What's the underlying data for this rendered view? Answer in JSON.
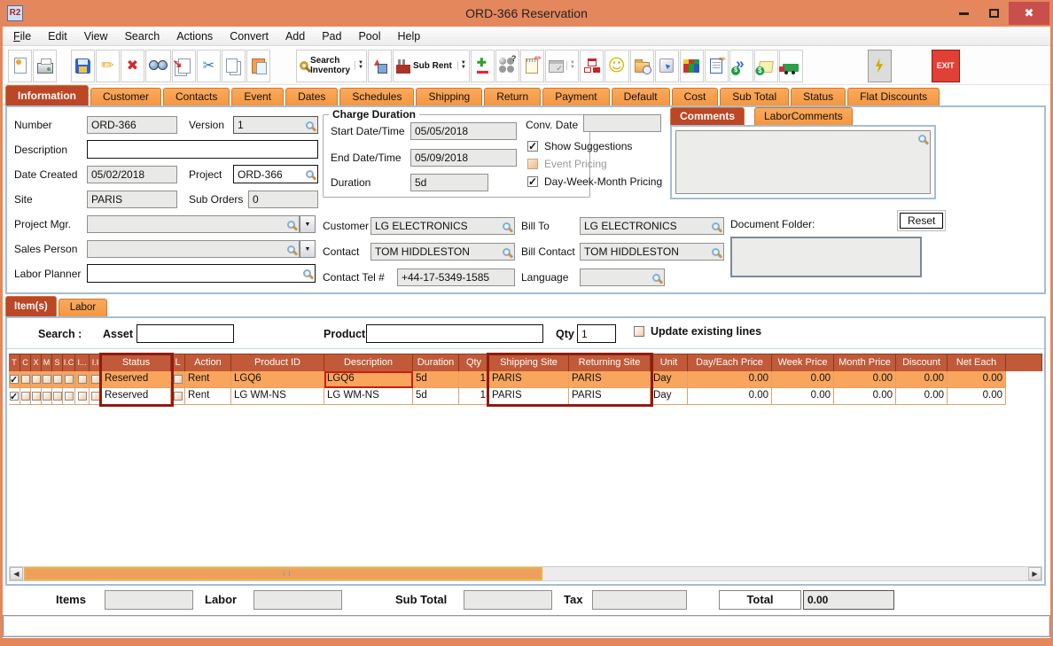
{
  "window": {
    "title": "ORD-366 Reservation",
    "app_icon_text": "R2"
  },
  "menu": {
    "items": [
      "File",
      "Edit",
      "View",
      "Search",
      "Actions",
      "Convert",
      "Add",
      "Pad",
      "Pool",
      "Help"
    ]
  },
  "toolbar": {
    "search_inventory_line1": "Search",
    "search_inventory_line2": "Inventory",
    "sub_rent_label": "Sub Rent",
    "exit_label": "EXIT"
  },
  "tabs": {
    "active": "Information",
    "items": [
      "Information",
      "Customer",
      "Contacts",
      "Event",
      "Dates",
      "Schedules",
      "Shipping",
      "Return",
      "Payment",
      "Default",
      "Cost",
      "Sub Total",
      "Status",
      "Flat Discounts"
    ]
  },
  "information": {
    "number_label": "Number",
    "number_value": "ORD-366",
    "version_label": "Version",
    "version_value": "1",
    "description_label": "Description",
    "description_value": "",
    "date_created_label": "Date Created",
    "date_created_value": "05/02/2018",
    "project_label": "Project",
    "project_value": "ORD-366",
    "site_label": "Site",
    "site_value": "PARIS",
    "sub_orders_label": "Sub Orders",
    "sub_orders_value": "0",
    "project_mgr_label": "Project Mgr.",
    "project_mgr_value": "",
    "sales_person_label": "Sales Person",
    "sales_person_value": "",
    "labor_planner_label": "Labor Planner",
    "labor_planner_value": "",
    "charge_duration": {
      "title": "Charge Duration",
      "start_label": "Start Date/Time",
      "start_value": "05/05/2018",
      "end_label": "End Date/Time",
      "end_value": "05/09/2018",
      "duration_label": "Duration",
      "duration_value": "5d"
    },
    "conv_date_label": "Conv. Date",
    "conv_date_value": "",
    "options": [
      {
        "label": "Show Suggestions",
        "checked": true,
        "enabled": true
      },
      {
        "label": "Event Pricing",
        "checked": false,
        "enabled": false
      },
      {
        "label": "Day-Week-Month Pricing",
        "checked": true,
        "enabled": true
      }
    ],
    "comments": {
      "tabs": [
        "Comments",
        "LaborComments"
      ],
      "active": "Comments",
      "text": ""
    },
    "customer_label": "Customer",
    "customer_value": "LG ELECTRONICS",
    "bill_to_label": "Bill To",
    "bill_to_value": "LG ELECTRONICS",
    "contact_label": "Contact",
    "contact_value": "TOM HIDDLESTON",
    "bill_contact_label": "Bill Contact",
    "bill_contact_value": "TOM HIDDLESTON",
    "contact_tel_label": "Contact Tel #",
    "contact_tel_value": "+44-17-5349-1585",
    "language_label": "Language",
    "language_value": "",
    "document_folder": {
      "label": "Document Folder:",
      "reset_label": "Reset",
      "text": ""
    }
  },
  "items_section": {
    "tabs": [
      "Item(s)",
      "Labor"
    ],
    "active": "Item(s)",
    "search": {
      "label": "Search :",
      "asset_label": "Asset",
      "asset_value": "",
      "product_label": "Product",
      "product_value": "",
      "qty_label": "Qty",
      "qty_value": "1",
      "update_label": "Update existing lines",
      "update_checked": false
    },
    "table": {
      "columns": [
        "T",
        "C",
        "X",
        "M",
        "S",
        "I.C",
        "I...",
        "I.I",
        "Status",
        "L",
        "Action",
        "Product ID",
        "Description",
        "Duration",
        "Qty",
        "Shipping Site",
        "Returning Site",
        "Unit",
        "Day/Each Price",
        "Week Price",
        "Month Price",
        "Discount",
        "Net Each"
      ],
      "rows": [
        {
          "checks": [
            true,
            false,
            false,
            false,
            false,
            false,
            false,
            false
          ],
          "status": "Reserved",
          "l_checked": false,
          "action": "Rent",
          "product_id": "LGQ6",
          "description": "LGQ6",
          "duration": "5d",
          "qty": "1",
          "shipping_site": "PARIS",
          "returning_site": "PARIS",
          "unit": "Day",
          "day_each_price": "0.00",
          "week_price": "0.00",
          "month_price": "0.00",
          "discount": "0.00",
          "net_each": "0.00"
        },
        {
          "checks": [
            true,
            false,
            false,
            false,
            false,
            false,
            false,
            false
          ],
          "status": "Reserved",
          "l_checked": false,
          "action": "Rent",
          "product_id": "LG WM-NS",
          "description": "LG WM-NS",
          "duration": "5d",
          "qty": "1",
          "shipping_site": "PARIS",
          "returning_site": "PARIS",
          "unit": "Day",
          "day_each_price": "0.00",
          "week_price": "0.00",
          "month_price": "0.00",
          "discount": "0.00",
          "net_each": "0.00"
        }
      ]
    }
  },
  "totals": {
    "items_label": "Items",
    "items_value": "",
    "labor_label": "Labor",
    "labor_value": "",
    "sub_total_label": "Sub Total",
    "sub_total_value": "",
    "tax_label": "Tax",
    "tax_value": "",
    "total_label": "Total",
    "total_value": "0.00"
  },
  "icons": {
    "window_close": "✕",
    "window_minimize": "–",
    "window_maximize": "□",
    "lookup": "magnifier",
    "dropdown": "▼",
    "scroll_left": "◀",
    "scroll_right": "▶",
    "check": "✓"
  },
  "colors": {
    "titlebar": "#E5875C",
    "tab_orange": "#F5973F",
    "tab_active": "#BC4626",
    "table_header": "#C05A39",
    "row_selected": "#F9A55C",
    "close_button": "#C94F4C",
    "highlight_border": "#8E1C10"
  }
}
